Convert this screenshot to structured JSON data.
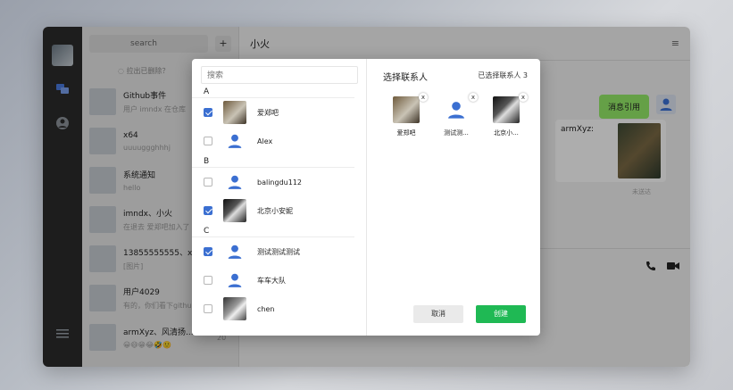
{
  "sidebar": {
    "search_placeholder": "search",
    "add_label": "+",
    "notice": "◌ 拉出已删除？",
    "conversations": [
      {
        "title": "Github事件",
        "subtitle": "用户 imndx 在仓库",
        "time": ""
      },
      {
        "title": "x64",
        "subtitle": "uuuuggghhhj",
        "time": ""
      },
      {
        "title": "系统通知",
        "subtitle": "hello",
        "time": ""
      },
      {
        "title": "imndx、小火",
        "subtitle": "在退去 爱郑吧加入了",
        "time": ""
      },
      {
        "title": "13855555555、x...",
        "subtitle": "[图片]",
        "time": ""
      },
      {
        "title": "用户4029",
        "subtitle": "有的，你们看下github",
        "time": "20"
      },
      {
        "title": "armXyz、风清扬...",
        "subtitle": "😀😄😁😂🤣🙂",
        "time": "20"
      }
    ]
  },
  "chat": {
    "title": "小火",
    "menu_icon": "menu-icon",
    "my_message": "消息引用",
    "other_name": "armXyz:",
    "sent_status": "未送达"
  },
  "dialog": {
    "search_placeholder": "搜索",
    "right_title": "选择联系人",
    "selected_label": "已选择联系人 3",
    "groups": [
      {
        "letter": "A",
        "contacts": [
          {
            "name": "爱郑吧",
            "checked": true,
            "avatar": "photo1"
          },
          {
            "name": "Alex",
            "checked": false,
            "avatar": "user"
          }
        ]
      },
      {
        "letter": "B",
        "contacts": [
          {
            "name": "balingdu112",
            "checked": false,
            "avatar": "user"
          },
          {
            "name": "北京小安妮",
            "checked": true,
            "avatar": "photo2"
          }
        ]
      },
      {
        "letter": "C",
        "contacts": [
          {
            "name": "测试测试测试",
            "checked": true,
            "avatar": "user"
          },
          {
            "name": "车车大队",
            "checked": false,
            "avatar": "user"
          },
          {
            "name": "chen",
            "checked": false,
            "avatar": "photo3"
          }
        ]
      }
    ],
    "selected": [
      {
        "name": "爱郑吧",
        "avatar": "photo1"
      },
      {
        "name": "测试测...",
        "avatar": "user"
      },
      {
        "name": "北京小...",
        "avatar": "photo2"
      }
    ],
    "remove_glyph": "x",
    "cancel_label": "取消",
    "create_label": "创建"
  },
  "colors": {
    "accent_blue": "#3b6fd1",
    "create_green": "#1fb954",
    "bubble_green": "#95ec69"
  }
}
